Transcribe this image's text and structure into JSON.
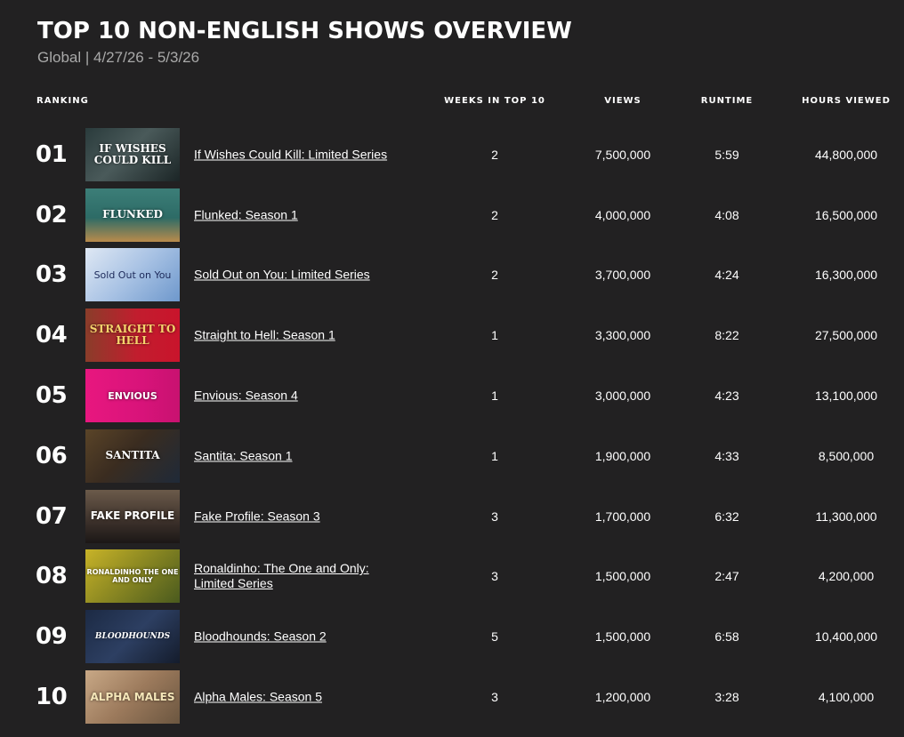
{
  "page": {
    "title": "TOP 10 NON-ENGLISH SHOWS OVERVIEW",
    "subtitle": "Global | 4/27/26 - 5/3/26"
  },
  "columns": {
    "ranking": "RANKING",
    "weeks": "WEEKS IN TOP 10",
    "views": "VIEWS",
    "runtime": "RUNTIME",
    "hours": "HOURS VIEWED"
  },
  "rows": [
    {
      "rank": "01",
      "thumb": "IF WISHES COULD KILL",
      "title": "If Wishes Could Kill: Limited Series",
      "weeks": "2",
      "views": "7,500,000",
      "runtime": "5:59",
      "hours": "44,800,000"
    },
    {
      "rank": "02",
      "thumb": "FLUNKED",
      "title": "Flunked: Season 1",
      "weeks": "2",
      "views": "4,000,000",
      "runtime": "4:08",
      "hours": "16,500,000"
    },
    {
      "rank": "03",
      "thumb": "Sold Out on You",
      "title": "Sold Out on You: Limited Series",
      "weeks": "2",
      "views": "3,700,000",
      "runtime": "4:24",
      "hours": "16,300,000"
    },
    {
      "rank": "04",
      "thumb": "STRAIGHT TO HELL",
      "title": "Straight to Hell: Season 1",
      "weeks": "1",
      "views": "3,300,000",
      "runtime": "8:22",
      "hours": "27,500,000"
    },
    {
      "rank": "05",
      "thumb": "ENVIOUS",
      "title": "Envious: Season 4",
      "weeks": "1",
      "views": "3,000,000",
      "runtime": "4:23",
      "hours": "13,100,000"
    },
    {
      "rank": "06",
      "thumb": "SANTITA",
      "title": "Santita: Season 1",
      "weeks": "1",
      "views": "1,900,000",
      "runtime": "4:33",
      "hours": "8,500,000"
    },
    {
      "rank": "07",
      "thumb": "FAKE PROFILE",
      "title": "Fake Profile: Season 3",
      "weeks": "3",
      "views": "1,700,000",
      "runtime": "6:32",
      "hours": "11,300,000"
    },
    {
      "rank": "08",
      "thumb": "RONALDINHO THE ONE AND ONLY",
      "title": "Ronaldinho: The One and Only: Limited Series",
      "weeks": "3",
      "views": "1,500,000",
      "runtime": "2:47",
      "hours": "4,200,000"
    },
    {
      "rank": "09",
      "thumb": "BLOODHOUNDS",
      "title": "Bloodhounds: Season 2",
      "weeks": "5",
      "views": "1,500,000",
      "runtime": "6:58",
      "hours": "10,400,000"
    },
    {
      "rank": "10",
      "thumb": "ALPHA MALES",
      "title": "Alpha Males: Season 5",
      "weeks": "3",
      "views": "1,200,000",
      "runtime": "3:28",
      "hours": "4,100,000"
    }
  ]
}
